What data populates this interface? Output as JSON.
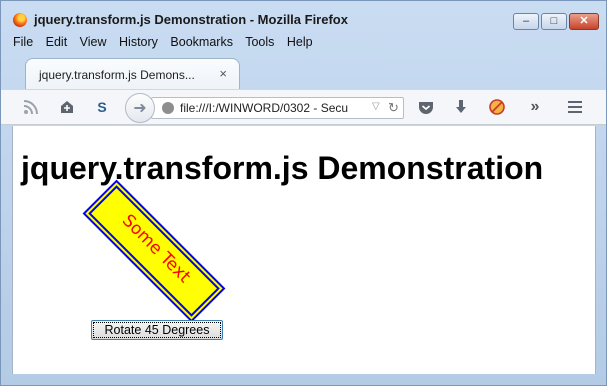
{
  "window": {
    "title": "jquery.transform.js Demonstration - Mozilla Firefox",
    "controls": {
      "minimize": "–",
      "maximize": "□",
      "close": "✕"
    }
  },
  "menu": [
    "File",
    "Edit",
    "View",
    "History",
    "Bookmarks",
    "Tools",
    "Help"
  ],
  "tab": {
    "label": "jquery.transform.js Demons...",
    "close": "×"
  },
  "toolbar": {
    "url": "file:///I:/WINWORD/0302 - Secu",
    "icons": [
      "rss-icon",
      "bookmark-add-icon",
      "s-addon-icon",
      "back-icon",
      "globe-icon",
      "reload-icon",
      "pocket-icon",
      "download-icon",
      "blocker-icon",
      "overflow-icon",
      "menu-icon"
    ]
  },
  "page": {
    "heading": "jquery.transform.js Demonstration",
    "rotated_text": "Some Text",
    "rotation_degrees": 45,
    "button_label": "Rotate 45 Degrees"
  },
  "colors": {
    "box_fill": "#ffff00",
    "box_border": "#0000ff",
    "text": "#ff0000"
  }
}
